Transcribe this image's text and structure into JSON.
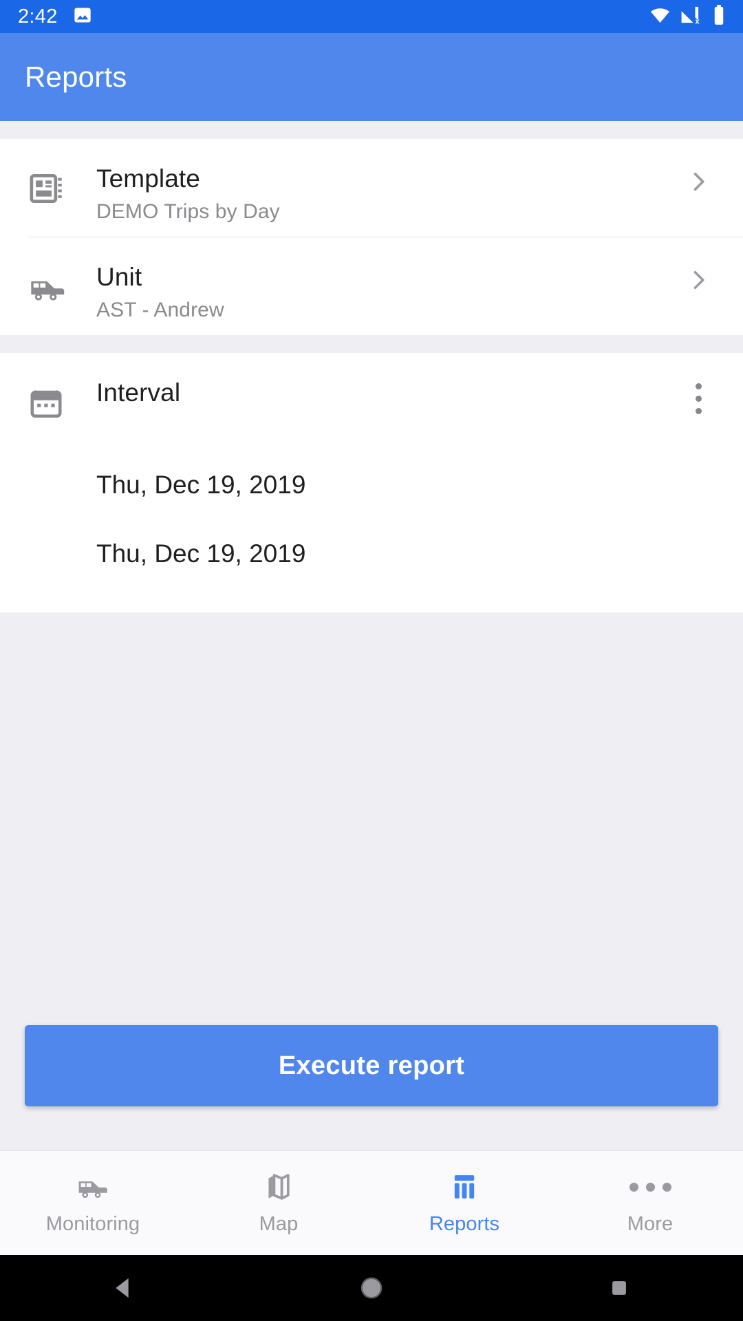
{
  "status_bar": {
    "time": "2:42",
    "icons": [
      "image-notification-icon",
      "wifi-icon",
      "cellular-no-service-icon",
      "battery-full-icon"
    ],
    "background": "#1a67e8"
  },
  "app_bar": {
    "title": "Reports",
    "background": "#5087ec"
  },
  "form": {
    "rows": [
      {
        "icon": "report-template-icon",
        "title": "Template",
        "subtitle": "DEMO Trips by Day",
        "action": "chevron-right-icon"
      },
      {
        "icon": "vehicle-bus-icon",
        "title": "Unit",
        "subtitle": "AST - Andrew",
        "action": "chevron-right-icon"
      }
    ],
    "interval": {
      "icon": "calendar-icon",
      "title": "Interval",
      "action": "overflow-menu-icon",
      "from_date": "Thu, Dec 19, 2019",
      "to_date": "Thu, Dec 19, 2019"
    }
  },
  "execute": {
    "label": "Execute report",
    "color": "#5087ec"
  },
  "bottom_nav": {
    "active_color": "#4285f4",
    "inactive_color": "#9a9aa0",
    "items": [
      {
        "label": "Monitoring",
        "icon": "vehicle-bus-icon",
        "active": false
      },
      {
        "label": "Map",
        "icon": "map-folded-icon",
        "active": false
      },
      {
        "label": "Reports",
        "icon": "bar-chart-icon",
        "active": true
      },
      {
        "label": "More",
        "icon": "more-horizontal-icon",
        "active": false
      }
    ]
  },
  "android_nav": {
    "buttons": [
      "back-icon",
      "home-icon",
      "recents-icon"
    ]
  }
}
